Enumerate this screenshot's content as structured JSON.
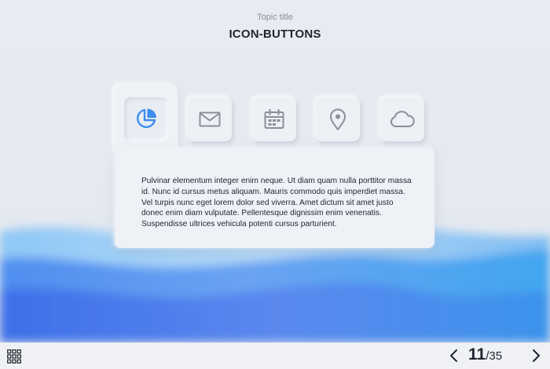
{
  "header": {
    "topic": "Topic title",
    "title": "ICON-BUTTONS"
  },
  "icon_buttons": [
    {
      "name": "pie-chart-icon",
      "selected": true
    },
    {
      "name": "envelope-icon",
      "selected": false
    },
    {
      "name": "calendar-icon",
      "selected": false
    },
    {
      "name": "location-pin-icon",
      "selected": false
    },
    {
      "name": "cloud-icon",
      "selected": false
    }
  ],
  "panel": {
    "text": "Pulvinar elementum integer enim neque. Ut diam quam nulla porttitor massa id. Nunc id cursus metus aliquam. Mauris commodo quis imperdiet massa. Vel turpis nunc eget lorem dolor sed viverra. Amet dictum sit amet justo donec enim diam vulputate. Pellentesque dignissim enim venenatis. Suspendisse ultrices vehicula potenti cursus parturient."
  },
  "nav": {
    "current_page": "11",
    "separator": "/",
    "total_pages": "35"
  },
  "colors": {
    "accent": "#3d8df0",
    "icon_gray": "#8a9099",
    "wave_light": "#7fc0f5",
    "wave_dark": "#4d7cf0"
  }
}
